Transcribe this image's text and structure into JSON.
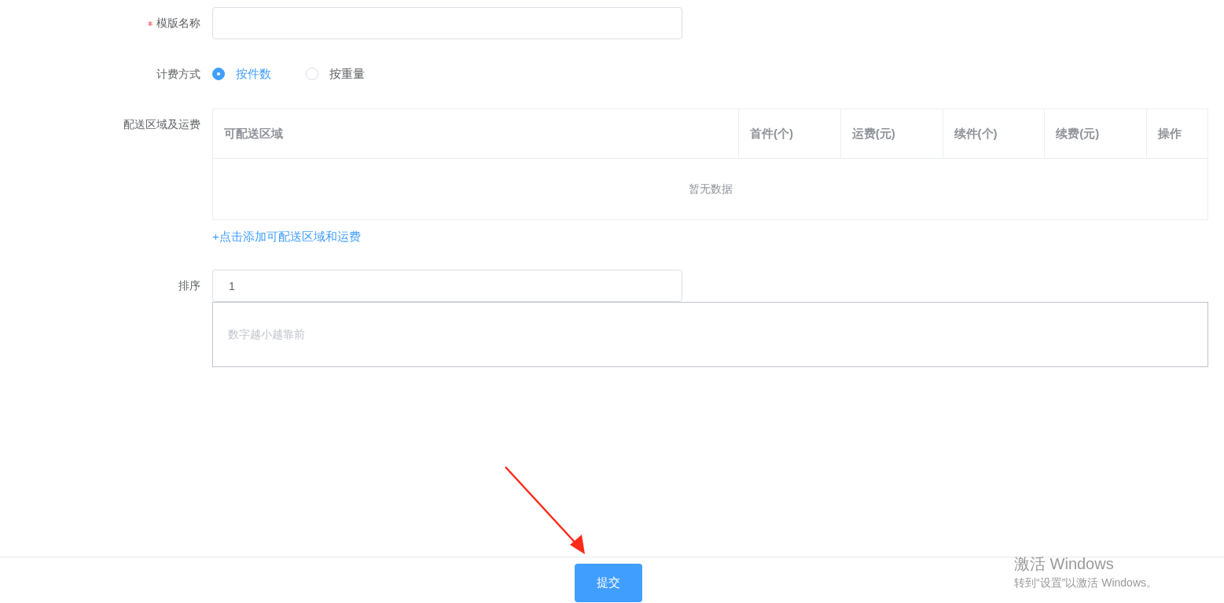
{
  "form": {
    "name_field": {
      "label": "模版名称",
      "required": true
    },
    "billing": {
      "label": "计费方式",
      "options": [
        {
          "label": "按件数",
          "selected": true
        },
        {
          "label": "按重量",
          "selected": false
        }
      ]
    },
    "delivery": {
      "label": "配送区域及运费",
      "table": {
        "columns": [
          "可配送区域",
          "首件(个)",
          "运费(元)",
          "续件(个)",
          "续费(元)",
          "操作"
        ],
        "empty_text": "暂无数据"
      },
      "add_link": "+点击添加可配送区域和运费"
    },
    "sort": {
      "label": "排序",
      "value": "1",
      "note_placeholder": "数字越小越靠前"
    }
  },
  "footer": {
    "submit": "提交"
  },
  "os_overlay": {
    "title": "激活 Windows",
    "message": "转到“设置”以激活 Windows。"
  }
}
